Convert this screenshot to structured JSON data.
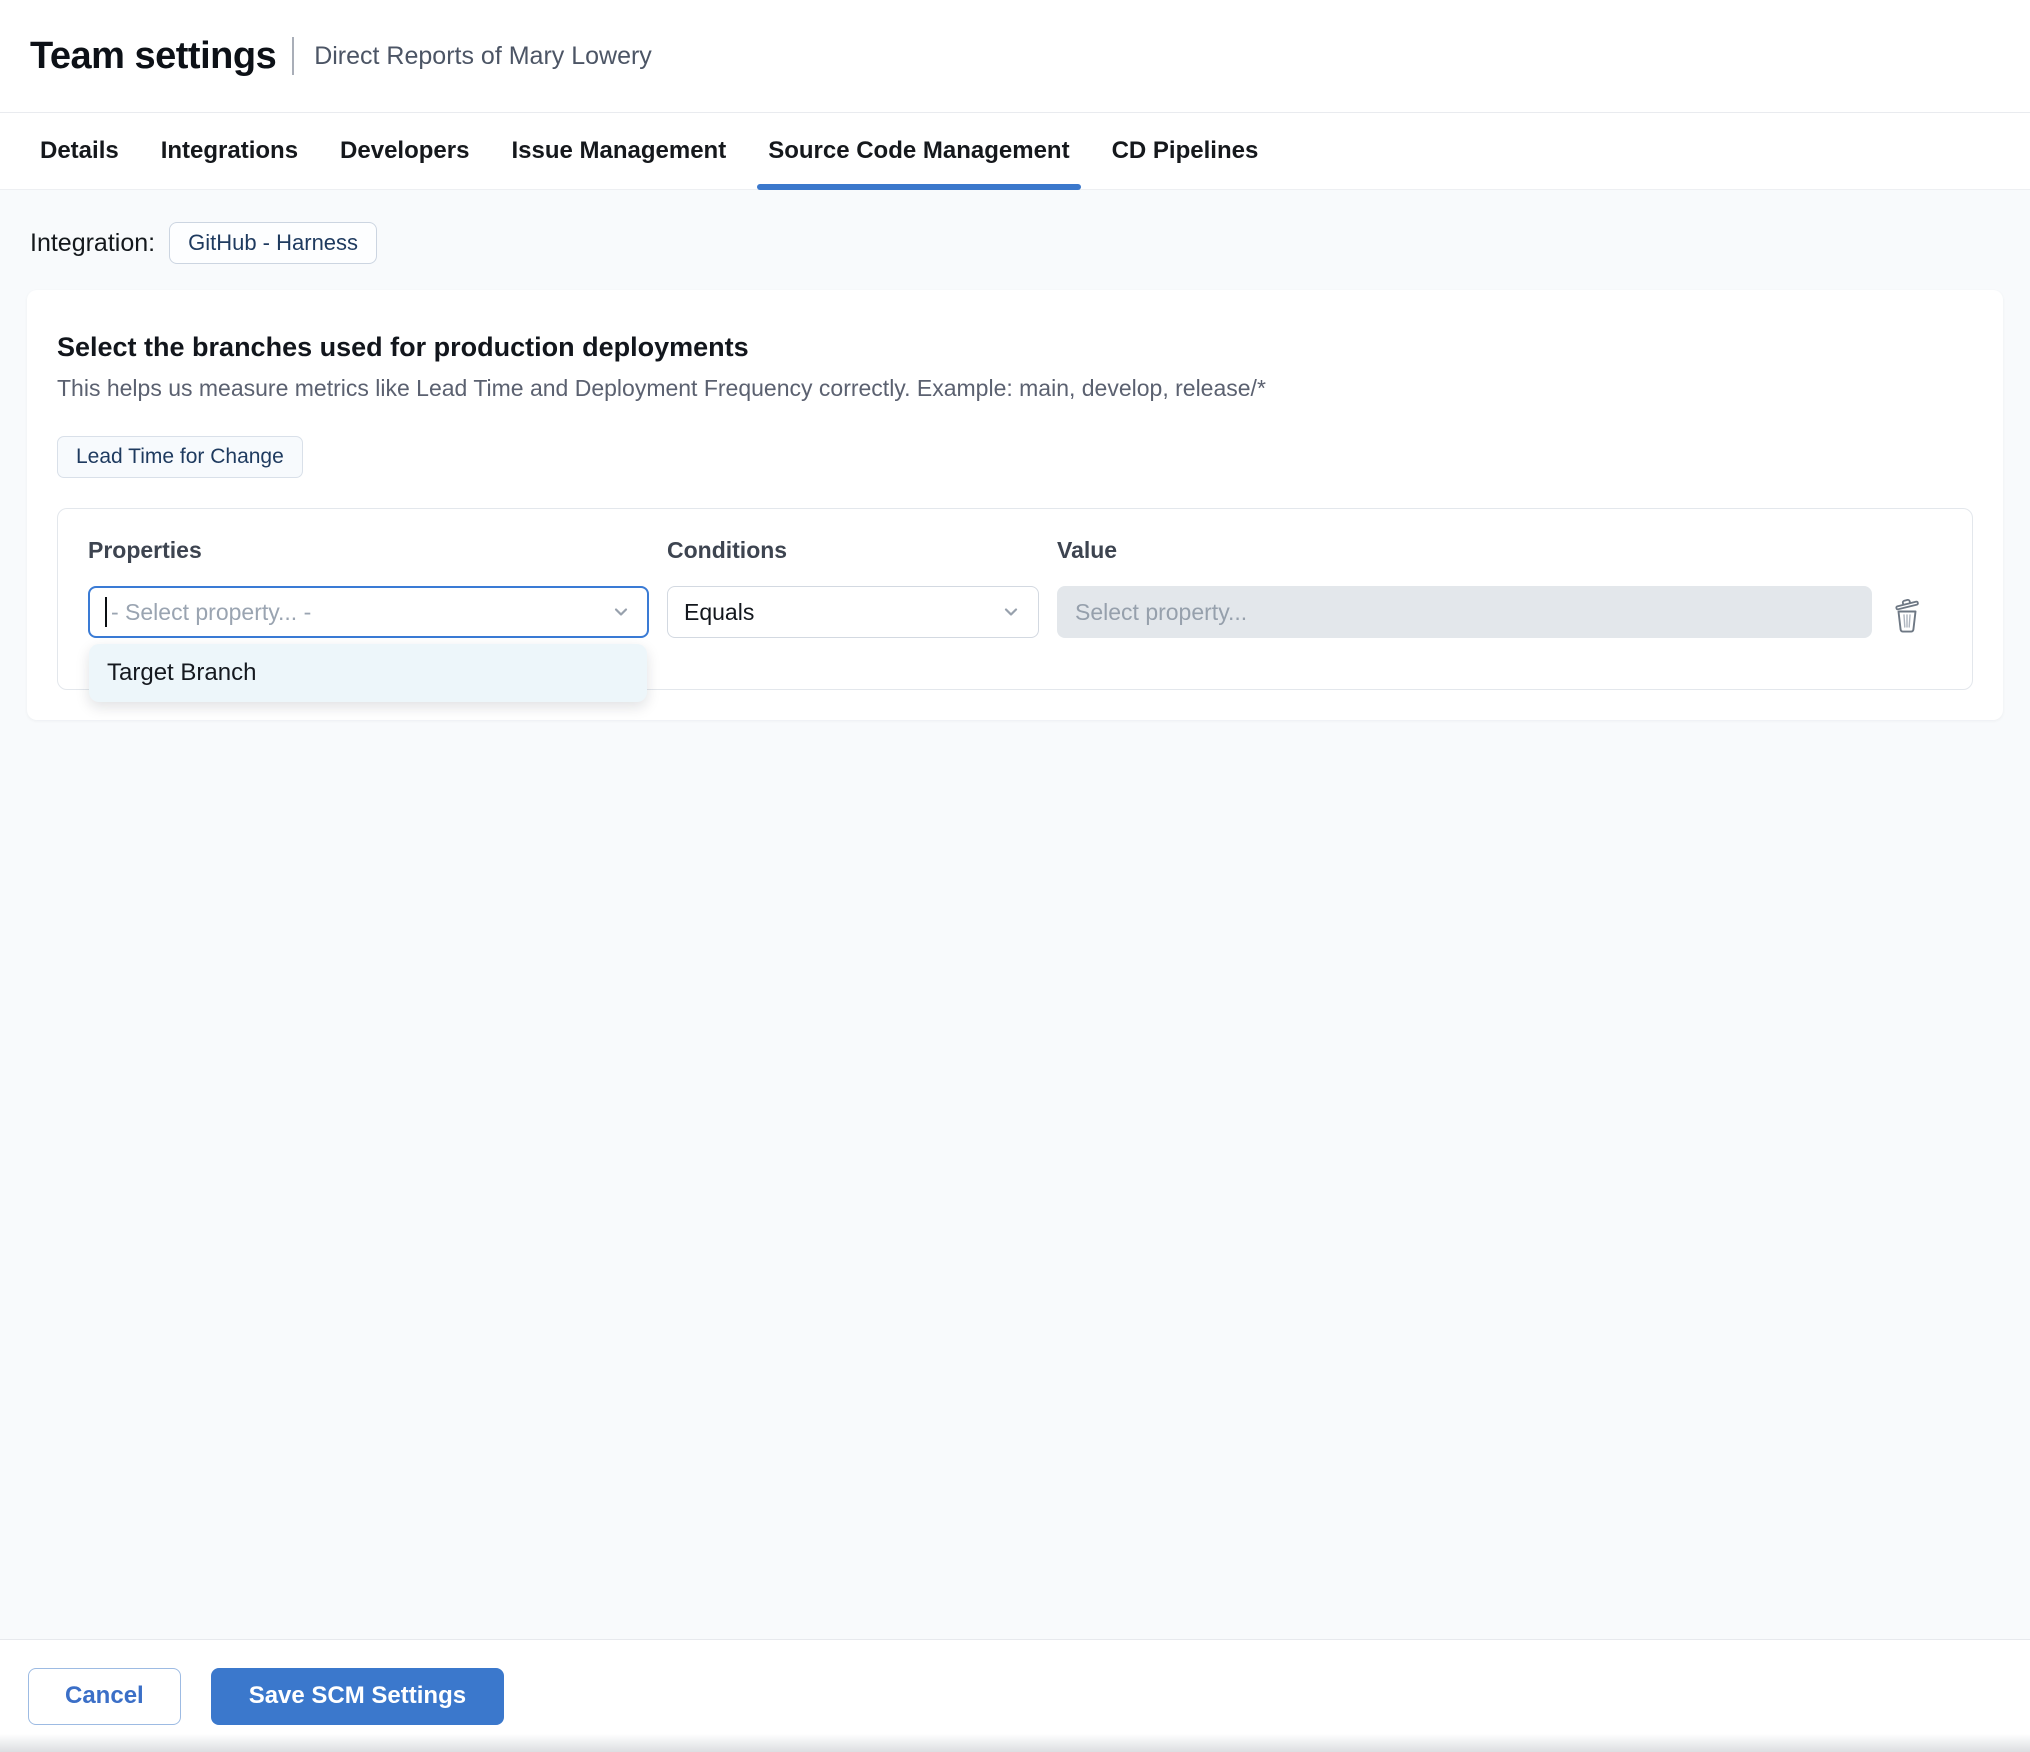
{
  "header": {
    "title": "Team settings",
    "subtitle": "Direct Reports of Mary Lowery"
  },
  "tabs": [
    {
      "label": "Details",
      "active": false
    },
    {
      "label": "Integrations",
      "active": false
    },
    {
      "label": "Developers",
      "active": false
    },
    {
      "label": "Issue Management",
      "active": false
    },
    {
      "label": "Source Code Management",
      "active": true
    },
    {
      "label": "CD Pipelines",
      "active": false
    }
  ],
  "integration": {
    "label": "Integration:",
    "chip": "GitHub - Harness"
  },
  "card": {
    "heading": "Select the branches used for production deployments",
    "description": "This helps us measure metrics like Lead Time and Deployment Frequency correctly. Example: main, develop, release/*",
    "metric_chip": "Lead Time for Change",
    "rule": {
      "properties_label": "Properties",
      "conditions_label": "Conditions",
      "value_label": "Value",
      "property_placeholder": "- Select property... -",
      "condition_value": "Equals",
      "value_placeholder": "Select property...",
      "dropdown_options": [
        "Target Branch"
      ]
    }
  },
  "footer": {
    "cancel_label": "Cancel",
    "save_label": "Save SCM Settings"
  },
  "icons": {
    "property_chevron": "chevron-down-icon",
    "condition_chevron": "chevron-down-icon",
    "delete": "trash-icon"
  },
  "colors": {
    "accent_blue": "#3b78cc",
    "tab_underline": "#3b78cc",
    "focus_border": "#3a7bd5",
    "chip_text_navy": "#1e3a5f",
    "content_background": "#f8fafc",
    "disabled_input_background": "#e3e7eb",
    "dropdown_background": "#edf6fa",
    "placeholder_gray": "#9aa4b1"
  }
}
